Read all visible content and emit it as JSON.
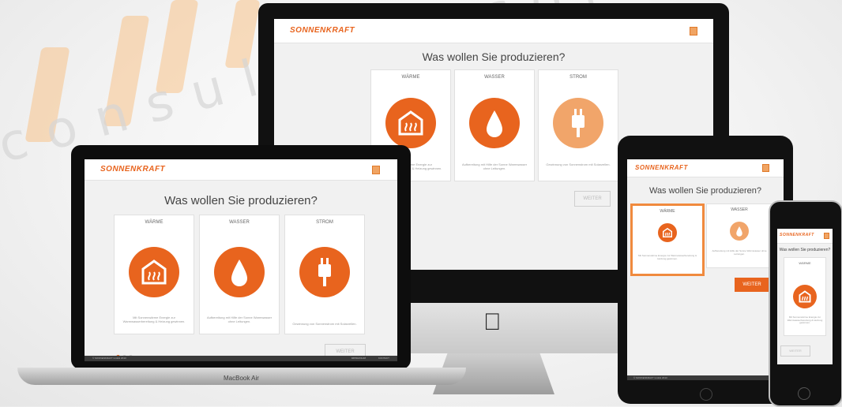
{
  "watermark": {
    "text": "consulting.solutions.pro"
  },
  "brand": {
    "logo": "SONNENKRAFT",
    "accent": "#e8641e"
  },
  "question": "Was wollen Sie produzieren?",
  "cards": [
    {
      "title": "WÄRME",
      "icon": "heat-icon",
      "desc": "Mit Sonnenwärme Energie zur Warmwasserbereitung & Heizung gewinnen."
    },
    {
      "title": "WASSER",
      "icon": "water-drop-icon",
      "desc": "Aufbereitung mit Hilfe der Sonne Warmwasser ohne Leitungen."
    },
    {
      "title": "STROM",
      "icon": "plug-icon",
      "desc": "Gewinnung von Sonnenstrom mit Solarzellen."
    }
  ],
  "next_button": "WEITER",
  "footer": {
    "left": "© SONNENKRAFT GmbH 2013",
    "right_1": "IMPRESSUM",
    "right_2": "KONTAKT"
  },
  "devices": {
    "laptop_label": "MacBook Air"
  },
  "phone": {
    "question": "Was wollen Sie produzieren?",
    "card_title": "WÄRME"
  }
}
